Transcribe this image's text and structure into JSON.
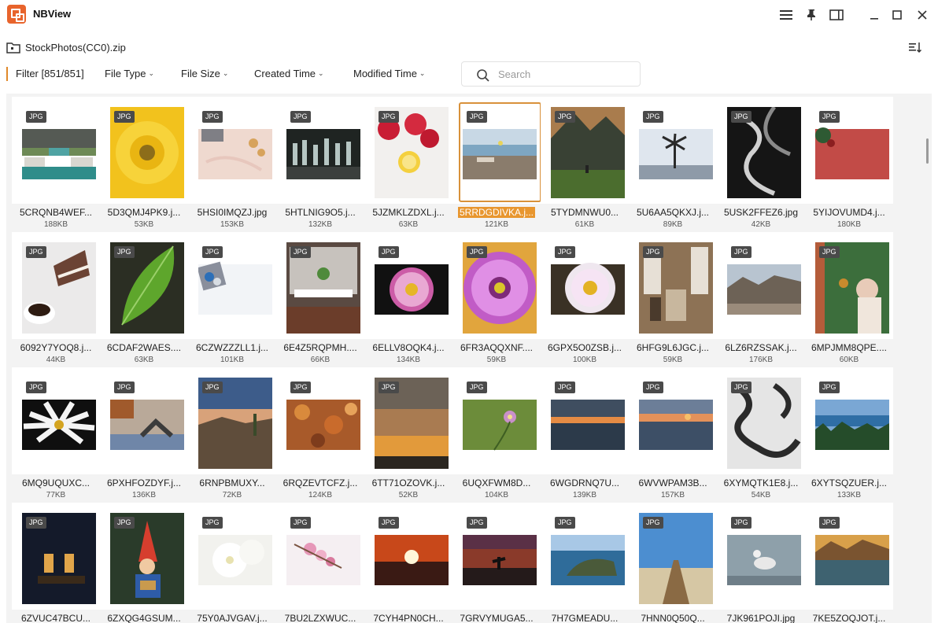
{
  "app": {
    "title": "NBView"
  },
  "path": {
    "label": "StockPhotos(CC0).zip"
  },
  "filters": {
    "filter_label": "Filter [851/851]",
    "file_type": "File Type",
    "file_size": "File Size",
    "created_time": "Created Time",
    "modified_time": "Modified Time",
    "search_placeholder": "Search"
  },
  "colors": {
    "accent": "#e8962f",
    "badge_bg": "#4a4a4a"
  },
  "selected_index": 5,
  "files": [
    {
      "type": "JPG",
      "name": "5CRQNB4WEF...",
      "size": "188KB",
      "art": "wall"
    },
    {
      "type": "JPG",
      "name": "5D3QMJ4PK9.j...",
      "size": "53KB",
      "art": "yellow-flower"
    },
    {
      "type": "JPG",
      "name": "5HSI0IMQZJ.jpg",
      "size": "153KB",
      "art": "blanket"
    },
    {
      "type": "JPG",
      "name": "5HTLNIG9O5.j...",
      "size": "132KB",
      "art": "chess"
    },
    {
      "type": "JPG",
      "name": "5JZMKLZDXL.j...",
      "size": "63KB",
      "art": "raspberries"
    },
    {
      "type": "JPG",
      "name": "5RRDGDIVKA.j...",
      "size": "121KB",
      "art": "beach"
    },
    {
      "type": "JPG",
      "name": "5TYDMNWU0...",
      "size": "61KB",
      "art": "mountain"
    },
    {
      "type": "JPG",
      "name": "5U6AA5QKXJ.j...",
      "size": "89KB",
      "art": "palm"
    },
    {
      "type": "JPG",
      "name": "5USK2FFEZ6.jpg",
      "size": "42KB",
      "art": "black-swirl"
    },
    {
      "type": "JPG",
      "name": "5YIJOVUMD4.j...",
      "size": "180KB",
      "art": "red-wall"
    },
    {
      "type": "JPG",
      "name": "6092Y7YOQ8.j...",
      "size": "44KB",
      "art": "cake"
    },
    {
      "type": "JPG",
      "name": "6CDAF2WAES....",
      "size": "63KB",
      "art": "leaf"
    },
    {
      "type": "JPG",
      "name": "6CZWZZZLL1.j...",
      "size": "101KB",
      "art": "ornaments"
    },
    {
      "type": "JPG",
      "name": "6E4Z5RQPMH....",
      "size": "66KB",
      "art": "dining"
    },
    {
      "type": "JPG",
      "name": "6ELLV8OQK4.j...",
      "size": "134KB",
      "art": "pink-daisy"
    },
    {
      "type": "JPG",
      "name": "6FR3AQQXNF....",
      "size": "59KB",
      "art": "purple-daisy"
    },
    {
      "type": "JPG",
      "name": "6GPX5O0ZSB.j...",
      "size": "100KB",
      "art": "white-daisy"
    },
    {
      "type": "JPG",
      "name": "6HFG9L6JGC.j...",
      "size": "59KB",
      "art": "cafe"
    },
    {
      "type": "JPG",
      "name": "6LZ6RZSSAK.j...",
      "size": "176KB",
      "art": "canyon"
    },
    {
      "type": "JPG",
      "name": "6MPJMM8QPE....",
      "size": "60KB",
      "art": "woman"
    },
    {
      "type": "JPG",
      "name": "6MQ9UQUXC...",
      "size": "77KB",
      "art": "daisy-dark"
    },
    {
      "type": "JPG",
      "name": "6PXHFOZDYF.j...",
      "size": "136KB",
      "art": "yoga"
    },
    {
      "type": "JPG",
      "name": "6RNPBMUXY...",
      "size": "72KB",
      "art": "desert"
    },
    {
      "type": "JPG",
      "name": "6RQZEVTCFZ.j...",
      "size": "124KB",
      "art": "autumn"
    },
    {
      "type": "JPG",
      "name": "6TT71OZOVK.j...",
      "size": "52KB",
      "art": "sunset-sky"
    },
    {
      "type": "JPG",
      "name": "6UQXFWM8D...",
      "size": "104KB",
      "art": "small-flower"
    },
    {
      "type": "JPG",
      "name": "6WGDRNQ7U...",
      "size": "139KB",
      "art": "lake-sunset"
    },
    {
      "type": "JPG",
      "name": "6WVWPAM3B...",
      "size": "157KB",
      "art": "ocean-sunset"
    },
    {
      "type": "JPG",
      "name": "6XYMQTK1E8.j...",
      "size": "54KB",
      "art": "bw-pattern"
    },
    {
      "type": "JPG",
      "name": "6XYTSQZUER.j...",
      "size": "133KB",
      "art": "lake-trees"
    },
    {
      "type": "JPG",
      "name": "6ZVUC47BCU...",
      "size": "",
      "art": "lanterns"
    },
    {
      "type": "JPG",
      "name": "6ZXQG4GSUM...",
      "size": "",
      "art": "gnome"
    },
    {
      "type": "JPG",
      "name": "75Y0AJVGAV.j...",
      "size": "",
      "art": "white-flower"
    },
    {
      "type": "JPG",
      "name": "7BU2LZXWUC...",
      "size": "",
      "art": "blossom"
    },
    {
      "type": "JPG",
      "name": "7CYH4PN0CH...",
      "size": "",
      "art": "red-sun"
    },
    {
      "type": "JPG",
      "name": "7GRVYMUGA5...",
      "size": "",
      "art": "dusk-tree"
    },
    {
      "type": "JPG",
      "name": "7H7GMEADU...",
      "size": "",
      "art": "coast"
    },
    {
      "type": "JPG",
      "name": "7HNN0Q50Q...",
      "size": "",
      "art": "boardwalk"
    },
    {
      "type": "JPG",
      "name": "7JK961POJI.jpg",
      "size": "",
      "art": "seagull"
    },
    {
      "type": "JPG",
      "name": "7KE5ZOQJOT.j...",
      "size": "",
      "art": "reflection"
    }
  ]
}
